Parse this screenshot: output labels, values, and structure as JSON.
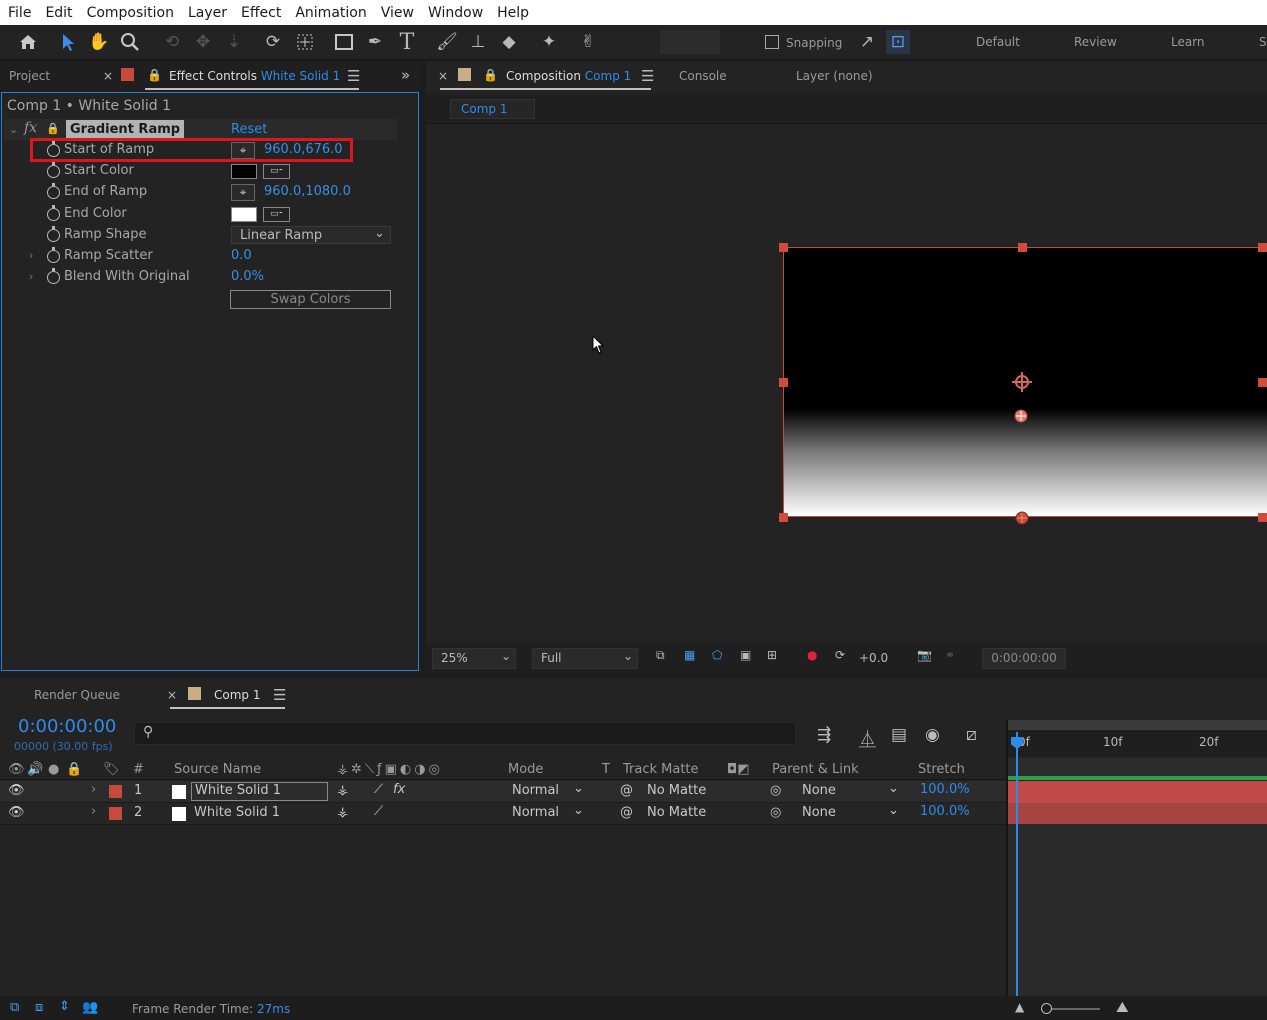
{
  "menu": [
    "File",
    "Edit",
    "Composition",
    "Layer",
    "Effect",
    "Animation",
    "View",
    "Window",
    "Help"
  ],
  "toolbar": {
    "snapping_label": "Snapping"
  },
  "workspaces": [
    "Default",
    "Review",
    "Learn",
    "S"
  ],
  "left_panel": {
    "project_tab": "Project",
    "effect_controls_label": "Effect Controls",
    "effect_controls_layer": "White Solid 1",
    "breadcrumb": "Comp 1 • White Solid 1",
    "fx_label": "fx",
    "effect_name": "Gradient Ramp",
    "reset_label": "Reset",
    "properties": [
      {
        "label": "Start of Ramp",
        "value": "960.0,676.0"
      },
      {
        "label": "Start Color",
        "value": ""
      },
      {
        "label": "End of Ramp",
        "value": "960.0,1080.0"
      },
      {
        "label": "End Color",
        "value": ""
      },
      {
        "label": "Ramp Shape",
        "value": "Linear Ramp"
      },
      {
        "label": "Ramp Scatter",
        "value": "0.0"
      },
      {
        "label": "Blend With Original",
        "value": "0.0%"
      }
    ],
    "swap_colors_label": "Swap Colors",
    "colors": {
      "start": "#000000",
      "end": "#ffffff",
      "highlight_box": "#e0141f"
    }
  },
  "comp_panel": {
    "composition_label": "Composition",
    "composition_name": "Comp 1",
    "console_tab": "Console",
    "layer_tab": "Layer (none)",
    "sub_tab": "Comp 1",
    "zoom": "25%",
    "resolution": "Full",
    "exposure": "+0.0",
    "timecode": "0:00:00:00"
  },
  "timeline": {
    "render_queue_tab": "Render Queue",
    "comp_tab": "Comp 1",
    "current_time": "0:00:00:00",
    "frame_info": "00000 (30.00 fps)",
    "ruler_labels": [
      "0f",
      "10f",
      "20f"
    ],
    "columns": {
      "num": "#",
      "source": "Source Name",
      "mode": "Mode",
      "t": "T",
      "track_matte": "Track Matte",
      "parent": "Parent & Link",
      "stretch": "Stretch"
    },
    "layers": [
      {
        "num": "1",
        "name": "White Solid 1",
        "mode": "Normal",
        "matte": "No Matte",
        "parent": "None",
        "stretch": "100.0%",
        "label_color": "#c84a3a"
      },
      {
        "num": "2",
        "name": "White Solid 1",
        "mode": "Normal",
        "matte": "No Matte",
        "parent": "None",
        "stretch": "100.0%",
        "label_color": "#c84a3a"
      }
    ]
  },
  "status": {
    "frame_render_label": "Frame Render Time:",
    "frame_render_value": "27ms"
  }
}
